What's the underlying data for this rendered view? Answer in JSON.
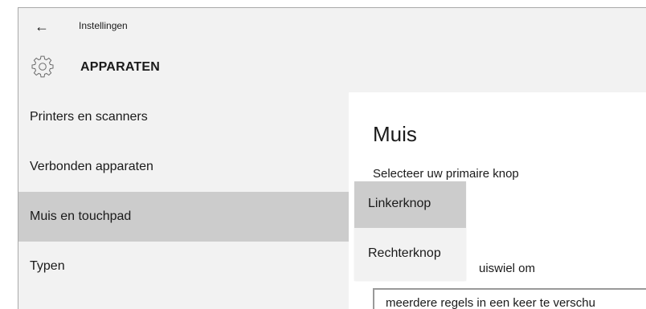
{
  "header": {
    "back_icon": "back-arrow-icon",
    "app_title": "Instellingen",
    "page_icon": "gear-icon",
    "page_title": "APPARATEN"
  },
  "sidebar": {
    "items": [
      {
        "label": "Printers en scanners",
        "selected": false
      },
      {
        "label": "Verbonden apparaten",
        "selected": false
      },
      {
        "label": "Muis en touchpad",
        "selected": true
      },
      {
        "label": "Typen",
        "selected": false
      }
    ]
  },
  "main": {
    "section_title": "Muis",
    "primary_button_label": "Selecteer uw primaire knop",
    "scroll_label_partial": "uiswiel om",
    "scroll_value": "meerdere regels in een keer te verschu"
  },
  "dropdown": {
    "options": [
      {
        "label": "Linkerknop",
        "selected": true
      },
      {
        "label": "Rechterknop",
        "selected": false
      }
    ]
  },
  "colors": {
    "header_bg": "#f2f2f2",
    "selected_bg": "#cccccc",
    "text": "#1a1a1a"
  }
}
